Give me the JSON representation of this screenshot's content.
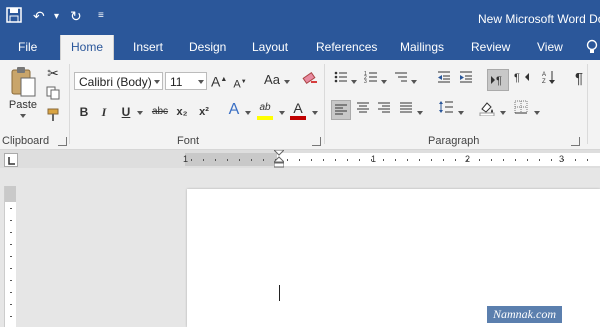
{
  "titlebar": {
    "title": "New Microsoft Word Do",
    "save_icon": "save-icon",
    "undo_icon": "undo-icon",
    "redo_icon": "redo-icon",
    "customize_icon": "customize-qat-icon"
  },
  "tabs": [
    "File",
    "Home",
    "Insert",
    "Design",
    "Layout",
    "References",
    "Mailings",
    "Review",
    "View"
  ],
  "active_tab": "Home",
  "clipboard": {
    "paste_label": "Paste",
    "group_label": "Clipboard"
  },
  "font": {
    "family": "Calibri (Body)",
    "size": "11",
    "case_label": "Aa",
    "bold": "B",
    "italic": "I",
    "underline": "U",
    "strike": "abc",
    "subscript": "x₂",
    "superscript": "x²",
    "effects": "A",
    "highlight": "ab",
    "color": "A",
    "grow": "A",
    "shrink": "A",
    "group_label": "Font",
    "highlight_color": "#ffff00",
    "font_color": "#c00000"
  },
  "paragraph": {
    "group_label": "Paragraph"
  },
  "ruler": {
    "numbers": [
      "1",
      "1",
      "2",
      "3"
    ]
  },
  "watermark": "Namnak.com",
  "colors": {
    "accent": "#2b579a"
  }
}
